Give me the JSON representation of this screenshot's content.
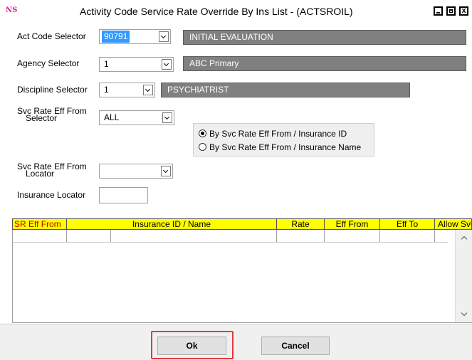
{
  "window": {
    "app_icon_text": "NS",
    "title": "Activity Code Service Rate Override By Ins List - (ACTSROIL)",
    "controls": {
      "close_glyph": "x"
    }
  },
  "form": {
    "act_code": {
      "label": "Act Code Selector",
      "value": "90791",
      "description": "INITIAL EVALUATION"
    },
    "agency": {
      "label": "Agency Selector",
      "value": "1",
      "description": "ABC Primary"
    },
    "discipline": {
      "label": "Discipline Selector",
      "value": "1",
      "description": "PSYCHIATRIST"
    },
    "svc_rate_eff_from_selector": {
      "label_line1": "Svc Rate Eff From",
      "label_line2": "Selector",
      "value": "ALL"
    },
    "sort_options": [
      {
        "label": "By Svc Rate Eff From / Insurance ID",
        "selected": true
      },
      {
        "label": "By Svc Rate Eff From / Insurance Name",
        "selected": false
      }
    ],
    "svc_rate_eff_from_locator": {
      "label_line1": "Svc Rate Eff From",
      "label_line2": "Locator",
      "value": ""
    },
    "insurance_locator": {
      "label": "Insurance Locator",
      "value": ""
    }
  },
  "grid": {
    "columns": [
      "SR Eff From",
      "Insurance ID / Name",
      "Rate",
      "Eff From",
      "Eff To",
      "Allow Svc"
    ],
    "rows": [],
    "header_color": "#ffff00"
  },
  "buttons": {
    "ok": "Ok",
    "cancel": "Cancel"
  },
  "colors": {
    "highlight_border": "#e03c3c",
    "selected_value_bg": "#3399ff",
    "readonly_field_bg": "#808080"
  }
}
